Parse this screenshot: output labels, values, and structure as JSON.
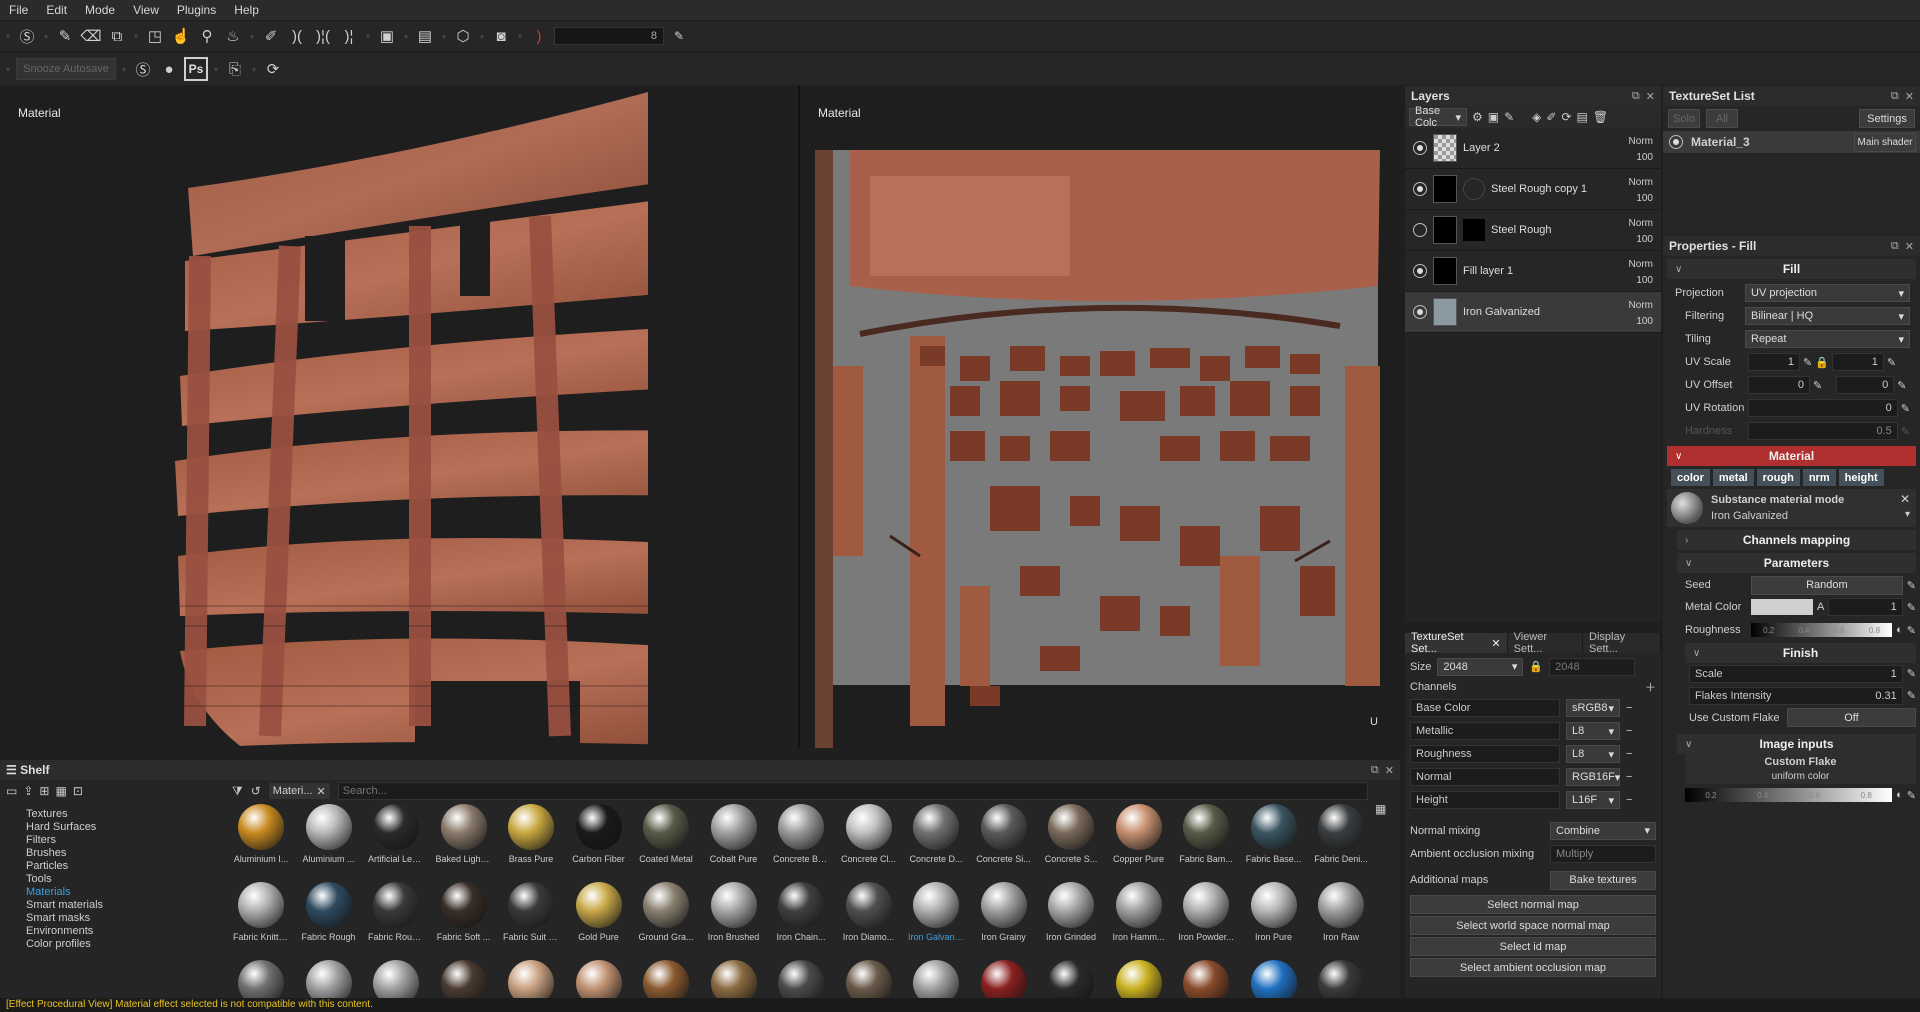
{
  "menu": [
    "File",
    "Edit",
    "Mode",
    "View",
    "Plugins",
    "Help"
  ],
  "toolbar": {
    "brush_size_value": "8",
    "snooze_label": "Snooze Autosave",
    "ps_label": "Ps"
  },
  "viewports": {
    "left_label": "Material",
    "right_label": "Material",
    "axis_left": {
      "y": "Y",
      "z": "Z",
      "x": "X"
    },
    "axis_right": {
      "u": "U"
    }
  },
  "layers": {
    "title": "Layers",
    "channel_dropdown": "Base Colc",
    "items": [
      {
        "name": "Layer 2",
        "blend": "Norm",
        "opacity": "100",
        "visible": true
      },
      {
        "name": "Steel Rough copy 1",
        "blend": "Norm",
        "opacity": "100",
        "visible": true
      },
      {
        "name": "Steel Rough",
        "blend": "Norm",
        "opacity": "100",
        "visible": false
      },
      {
        "name": "Fill layer 1",
        "blend": "Norm",
        "opacity": "100",
        "visible": true
      },
      {
        "name": "Iron Galvanized",
        "blend": "Norm",
        "opacity": "100",
        "visible": true
      }
    ]
  },
  "textureset_settings": {
    "tabs": [
      "TextureSet Set...",
      "Viewer Sett...",
      "Display Sett..."
    ],
    "size_label": "Size",
    "size_value": "2048",
    "size_value2": "2048",
    "channels_label": "Channels",
    "channels": [
      {
        "name": "Base Color",
        "format": "sRGB8"
      },
      {
        "name": "Metallic",
        "format": "L8"
      },
      {
        "name": "Roughness",
        "format": "L8"
      },
      {
        "name": "Normal",
        "format": "RGB16F"
      },
      {
        "name": "Height",
        "format": "L16F"
      }
    ],
    "normal_mixing_label": "Normal mixing",
    "normal_mixing_value": "Combine",
    "ao_mixing_label": "Ambient occlusion mixing",
    "ao_mixing_value": "Multiply",
    "additional_maps_label": "Additional maps",
    "bake_button": "Bake textures",
    "map_buttons": [
      "Select normal map",
      "Select world space normal map",
      "Select id map",
      "Select ambient occlusion map"
    ]
  },
  "textureset_list": {
    "title": "TextureSet List",
    "solo": "Solo",
    "all": "All",
    "settings": "Settings",
    "material_name": "Material_3",
    "shader": "Main shader"
  },
  "properties": {
    "title": "Properties - Fill",
    "fill_section": "Fill",
    "projection_label": "Projection",
    "projection_value": "UV projection",
    "filtering_label": "Filtering",
    "filtering_value": "Bilinear | HQ",
    "tiling_label": "Tiling",
    "tiling_value": "Repeat",
    "uv_scale_label": "UV Scale",
    "uv_scale_a": "1",
    "uv_scale_b": "1",
    "uv_offset_label": "UV Offset",
    "uv_offset_a": "0",
    "uv_offset_b": "0",
    "uv_rotation_label": "UV Rotation",
    "uv_rotation_value": "0",
    "hardness_label": "Hardness",
    "hardness_value": "0.5",
    "material_section": "Material",
    "chips": [
      "color",
      "metal",
      "rough",
      "nrm",
      "height"
    ],
    "substance_mode": "Substance material mode",
    "substance_name": "Iron Galvanized",
    "channels_mapping": "Channels mapping",
    "parameters": "Parameters",
    "seed_label": "Seed",
    "seed_button": "Random",
    "metal_color_label": "Metal Color",
    "metal_color_a": "A",
    "metal_color_value": "1",
    "roughness_label": "Roughness",
    "roughness_ticks": [
      "0.2",
      "0.4",
      "0.6",
      "0.8"
    ],
    "finish": "Finish",
    "scale_label": "Scale",
    "scale_value": "1",
    "flakes_label": "Flakes Intensity",
    "flakes_value": "0.31",
    "custom_flake_label": "Use Custom Flake",
    "custom_flake_value": "Off",
    "image_inputs": "Image inputs",
    "custom_flake_title": "Custom Flake",
    "custom_flake_sub": "uniform color",
    "ramp_ticks": [
      "0.2",
      "0.4",
      "0.6",
      "0.8"
    ]
  },
  "shelf": {
    "title": "Shelf",
    "filter_tag": "Materi...",
    "search_placeholder": "Search...",
    "categories": [
      "Textures",
      "Hard Surfaces",
      "Filters",
      "Brushes",
      "Particles",
      "Tools",
      "Materials",
      "Smart materials",
      "Smart masks",
      "Environments",
      "Color profiles"
    ],
    "selected_category": "Materials",
    "materials_row1": [
      {
        "name": "Aluminium I...",
        "color": "#c88a20"
      },
      {
        "name": "Aluminium ...",
        "color": "#b8b8b8"
      },
      {
        "name": "Artificial Leat...",
        "color": "#2a2a2a"
      },
      {
        "name": "Baked Lighti...",
        "color": "#8a7a6a"
      },
      {
        "name": "Brass Pure",
        "color": "#c8a840"
      },
      {
        "name": "Carbon Fiber",
        "color": "#1a1a1a"
      },
      {
        "name": "Coated Metal",
        "color": "#5a5a48"
      },
      {
        "name": "Cobalt Pure",
        "color": "#a0a0a0"
      },
      {
        "name": "Concrete Bare",
        "color": "#9a9a98"
      },
      {
        "name": "Concrete Cl...",
        "color": "#c0c0c0"
      },
      {
        "name": "Concrete D...",
        "color": "#707070"
      },
      {
        "name": "Concrete Si...",
        "color": "#5a5a5a"
      },
      {
        "name": "Concrete S...",
        "color": "#7a6a5a"
      },
      {
        "name": "Copper Pure",
        "color": "#c89070"
      },
      {
        "name": "Fabric Bam...",
        "color": "#5a5a48"
      },
      {
        "name": "Fabric Base...",
        "color": "#3a5560"
      },
      {
        "name": "Fabric Deni...",
        "color": "#3a3e40"
      }
    ],
    "materials_row2": [
      {
        "name": "Fabric Knitte...",
        "color": "#b0b0b0"
      },
      {
        "name": "Fabric Rough",
        "color": "#2e4a60"
      },
      {
        "name": "Fabric Roug...",
        "color": "#3a3a3a"
      },
      {
        "name": "Fabric Soft ...",
        "color": "#3a2e28"
      },
      {
        "name": "Fabric Suit V...",
        "color": "#3a3a3a"
      },
      {
        "name": "Gold Pure",
        "color": "#c8a848"
      },
      {
        "name": "Ground Gra...",
        "color": "#8a8070"
      },
      {
        "name": "Iron Brushed",
        "color": "#a8a8a8"
      },
      {
        "name": "Iron Chain...",
        "color": "#404040"
      },
      {
        "name": "Iron Diamo...",
        "color": "#505050"
      },
      {
        "name": "Iron Galvani...",
        "color": "#b0b0b0",
        "selected": true
      },
      {
        "name": "Iron Grainy",
        "color": "#a0a0a0"
      },
      {
        "name": "Iron Grinded",
        "color": "#a8a8a8"
      },
      {
        "name": "Iron Hamm...",
        "color": "#a0a0a0"
      },
      {
        "name": "Iron Powder...",
        "color": "#b0b0b0"
      },
      {
        "name": "Iron Pure",
        "color": "#b8b8b8"
      },
      {
        "name": "Iron Raw",
        "color": "#a0a0a0"
      }
    ],
    "materials_row3_colors": [
      "#707070",
      "#a0a0a0",
      "#a0a0a0",
      "#4a3a30",
      "#c8a080",
      "#c09070",
      "#8a5a30",
      "#8a6a40",
      "#4a4a4a",
      "#6a5a4a",
      "#a0a0a0",
      "#8a2020",
      "#2a2a2a",
      "#c8b020",
      "#8a4a2a",
      "#2070c0",
      "#3a3a3a"
    ]
  },
  "status": "[Effect Procedural View] Material effect selected is not compatible with this content."
}
